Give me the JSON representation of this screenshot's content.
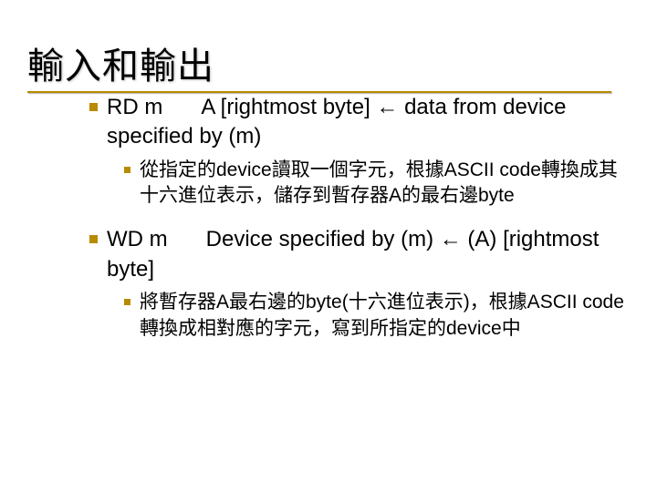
{
  "title": "輸入和輸出",
  "items": [
    {
      "main_prefix": "RD m",
      "main_rest": "A [rightmost byte] ← data from device specified by (m)",
      "sub": "從指定的device讀取一個字元，根據ASCII code轉換成其十六進位表示，儲存到暫存器A的最右邊byte"
    },
    {
      "main_prefix": "WD m",
      "main_rest": "Device specified by (m) ← (A) [rightmost byte]",
      "sub": "將暫存器A最右邊的byte(十六進位表示)，根據ASCII code轉換成相對應的字元，寫到所指定的device中"
    }
  ]
}
